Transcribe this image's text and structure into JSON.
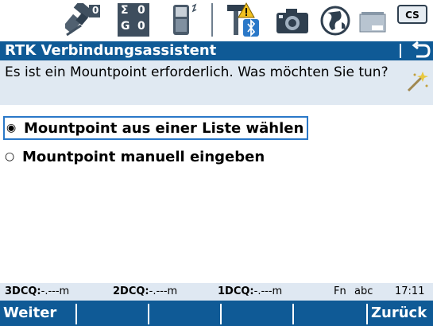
{
  "status_bar": {
    "satellite_count": "0",
    "sigma_top": "0",
    "sigma_bottom": "0",
    "sigma_label": "Σ",
    "g_label": "G",
    "cs_badge": "CS",
    "icons": [
      "satellite-icon",
      "sigma-glonass-icon",
      "controller-icon",
      "rtk-bluetooth-warning-icon",
      "camera-icon",
      "globe-icon",
      "memory-card-icon",
      "cs-badge-icon"
    ]
  },
  "title": {
    "text": "RTK Verbindungsassistent",
    "back_glyph": "⮌"
  },
  "message": {
    "text": "Es ist ein Mountpoint erforderlich. Was möchten Sie tun?"
  },
  "options": [
    {
      "label": "Mountpoint aus einer Liste wählen",
      "selected": true,
      "mark": "◉"
    },
    {
      "label": "Mountpoint manuell eingeben",
      "selected": false,
      "mark": "○"
    }
  ],
  "info_bar": {
    "dcq3_label": "3DCQ:",
    "dcq3_value": "-.---m",
    "dcq2_label": "2DCQ:",
    "dcq2_value": "-.---m",
    "dcq1_label": "1DCQ:",
    "dcq1_value": "-.---m",
    "fn": "Fn",
    "input_mode": "abc",
    "time": "17:11"
  },
  "softkeys": {
    "f1": "Weiter",
    "f6": "Zurück"
  },
  "colors": {
    "title_bg": "#0f5a96",
    "message_bg": "#e0e9f2",
    "selection_border": "#2a78c8",
    "warning": "#f0c020"
  }
}
